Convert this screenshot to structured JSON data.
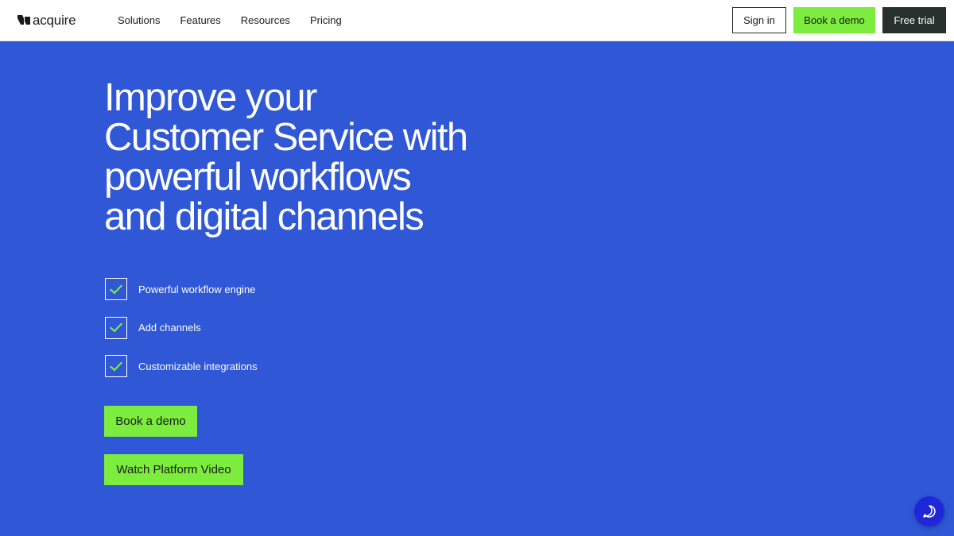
{
  "nav": {
    "logo_text": "acquire",
    "links": [
      "Solutions",
      "Features",
      "Resources",
      "Pricing"
    ],
    "sign_in": "Sign in",
    "book_demo": "Book a demo",
    "free_trial": "Free trial"
  },
  "hero": {
    "title_lines": [
      "Improve your",
      "Customer Service with",
      "powerful workflows",
      "and digital channels"
    ],
    "features": [
      "Powerful workflow engine",
      "Add channels",
      "Customizable integrations"
    ],
    "cta_demo": "Book a demo",
    "cta_video": "Watch Platform Video"
  },
  "colors": {
    "background": "#2f57d6",
    "accent_green": "#7cec3e",
    "dark_button": "#27302c",
    "chat_bubble": "#1f28d8"
  },
  "icons": {
    "logo": "acquire-logo-icon",
    "feature_check": "check-icon",
    "chat": "chat-icon"
  }
}
